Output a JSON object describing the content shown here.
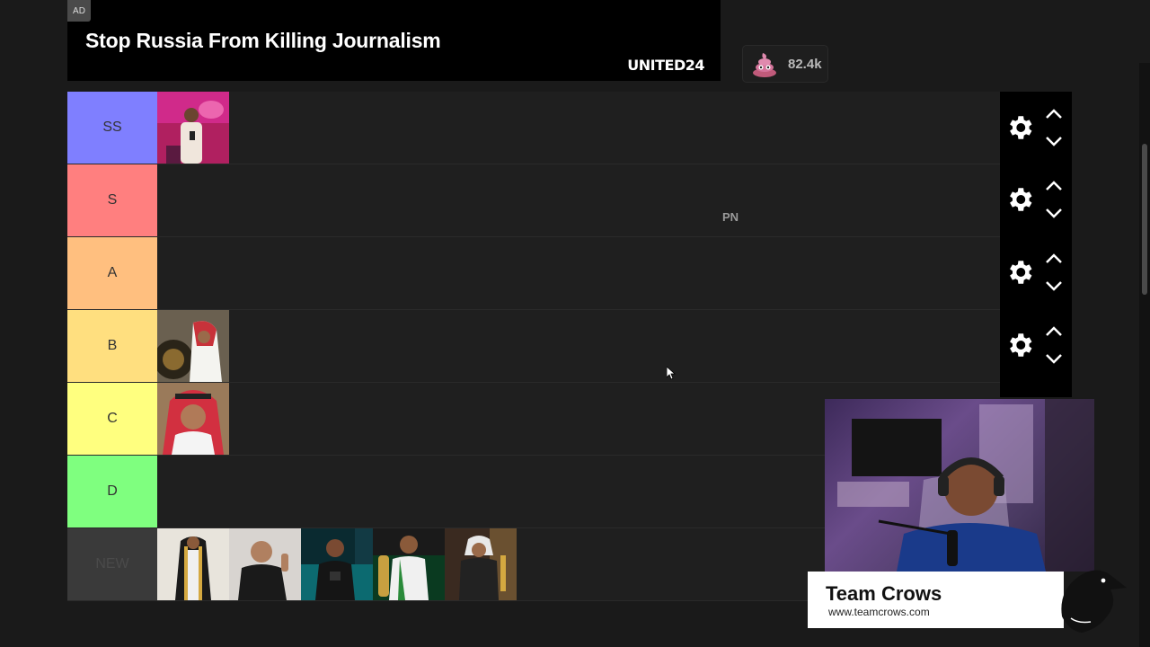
{
  "ad": {
    "badge": "AD",
    "headline": "Stop Russia From Killing Journalism",
    "brand": "UNITED24"
  },
  "likes": {
    "count": "82.4k",
    "icon": "poop-emoji-icon"
  },
  "tiers": [
    {
      "label": "SS",
      "color": "#7f7fff"
    },
    {
      "label": "S",
      "color": "#ff7f7f"
    },
    {
      "label": "A",
      "color": "#ffbf7f"
    },
    {
      "label": "B",
      "color": "#ffdf7f"
    },
    {
      "label": "C",
      "color": "#ffff7f"
    },
    {
      "label": "D",
      "color": "#7fff7f"
    },
    {
      "label": "NEW",
      "color": "#3a3a3a"
    }
  ],
  "overlay_text": "PN",
  "streamer": {
    "team": "Team Crows",
    "url": "www.teamcrows.com"
  }
}
